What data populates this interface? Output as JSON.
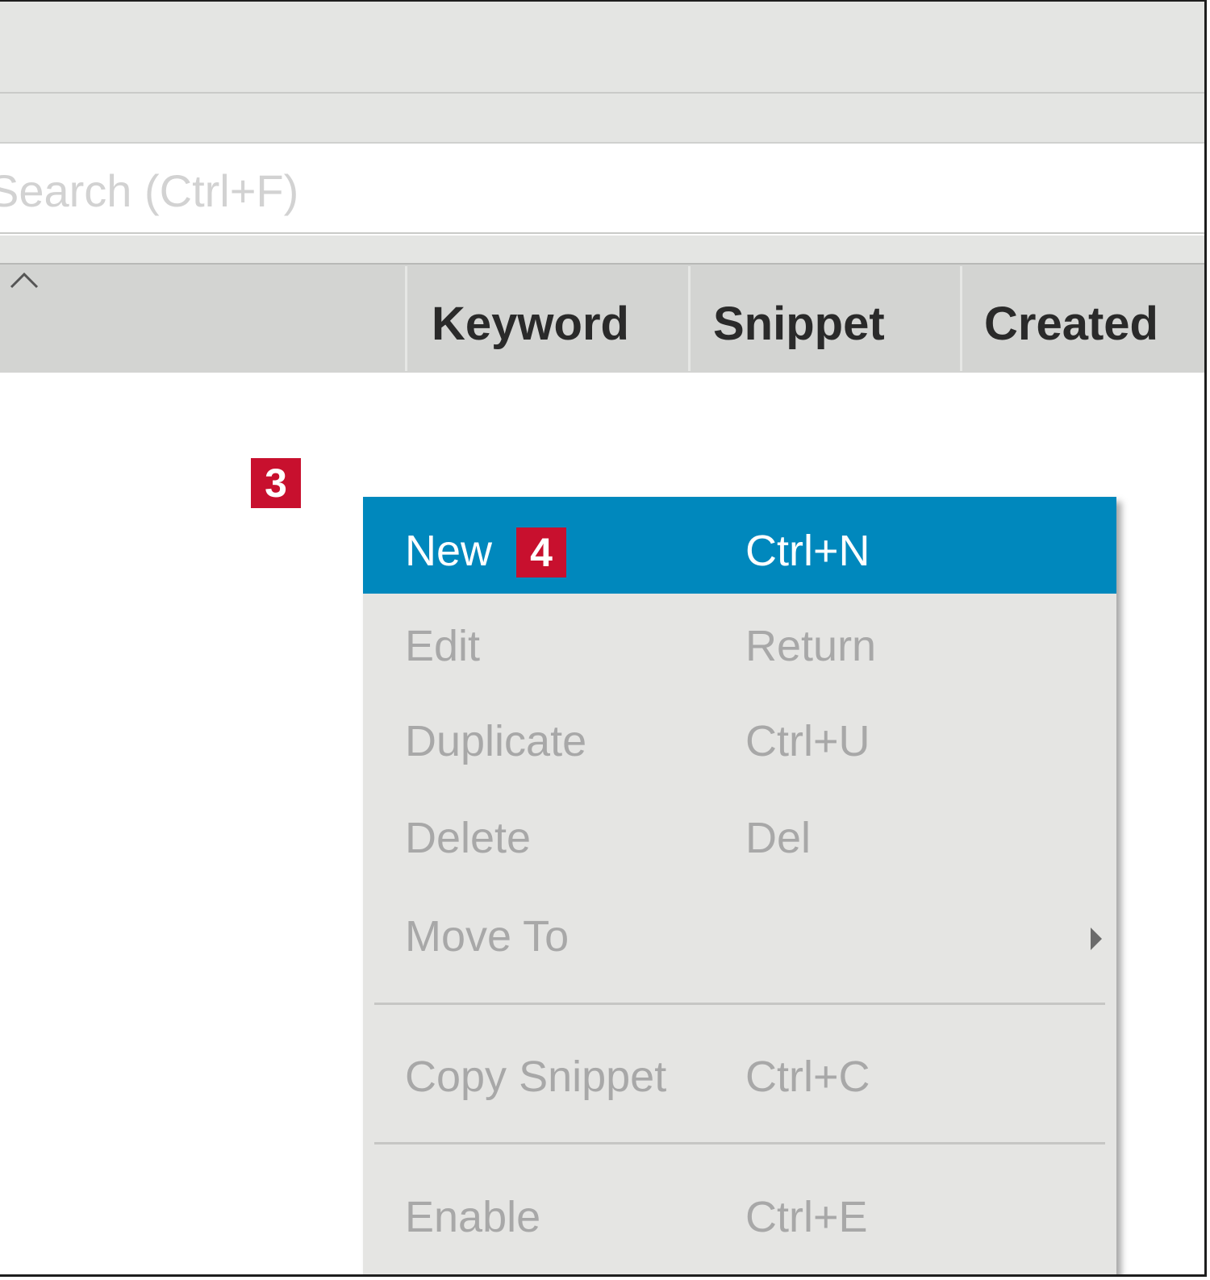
{
  "search": {
    "placeholder": "Search (Ctrl+F)"
  },
  "table": {
    "columns": [
      "Keyword",
      "Snippet",
      "Created"
    ]
  },
  "badges": {
    "step3": "3",
    "step4": "4"
  },
  "context_menu": {
    "items": [
      {
        "label": "New",
        "shortcut": "Ctrl+N",
        "highlighted": true
      },
      {
        "label": "Edit",
        "shortcut": "Return"
      },
      {
        "label": "Duplicate",
        "shortcut": "Ctrl+U"
      },
      {
        "label": "Delete",
        "shortcut": "Del"
      },
      {
        "label": "Move To",
        "shortcut": "",
        "submenu": true
      },
      {
        "label": "Copy Snippet",
        "shortcut": "Ctrl+C"
      },
      {
        "label": "Enable",
        "shortcut": "Ctrl+E"
      }
    ]
  },
  "colors": {
    "highlight": "#0088bd",
    "badge": "#c8102e",
    "disabled_text": "#a8a8a8"
  }
}
